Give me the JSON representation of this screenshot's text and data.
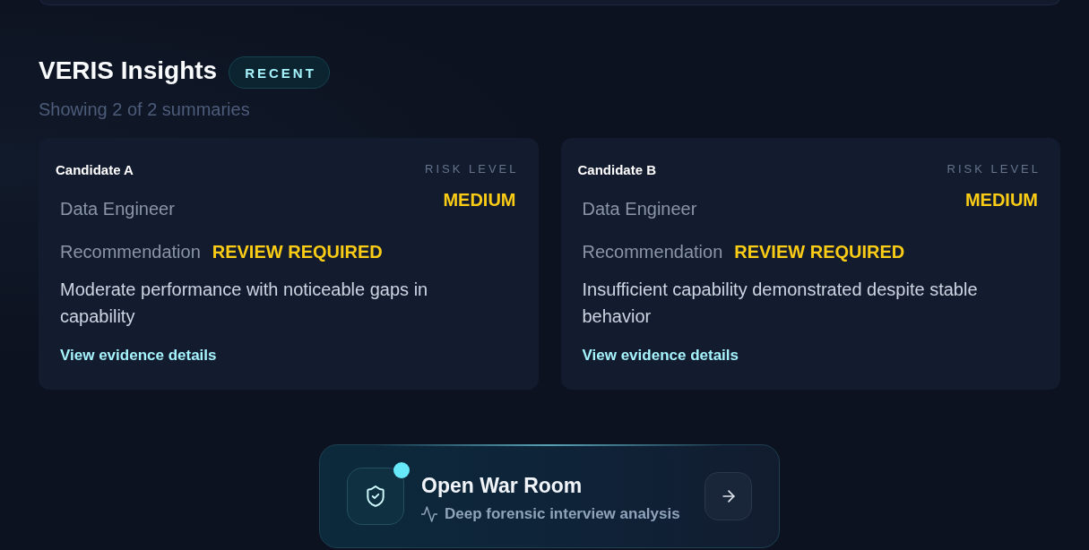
{
  "section": {
    "title": "VERIS Insights",
    "badge": "RECENT",
    "subtitle": "Showing 2 of 2 summaries"
  },
  "cards": [
    {
      "name": "Candidate A",
      "risk_label": "RISK LEVEL",
      "risk": "MEDIUM",
      "role": "Data Engineer",
      "recommendation_label": "Recommendation",
      "recommendation": "REVIEW REQUIRED",
      "summary": "Moderate performance with noticeable gaps in capability",
      "link": "View evidence details"
    },
    {
      "name": "Candidate B",
      "risk_label": "RISK LEVEL",
      "risk": "MEDIUM",
      "role": "Data Engineer",
      "recommendation_label": "Recommendation",
      "recommendation": "REVIEW REQUIRED",
      "summary": "Insufficient capability demonstrated despite stable behavior",
      "link": "View evidence details"
    }
  ],
  "war_room": {
    "title": "Open War Room",
    "subtitle": "Deep forensic interview analysis"
  }
}
